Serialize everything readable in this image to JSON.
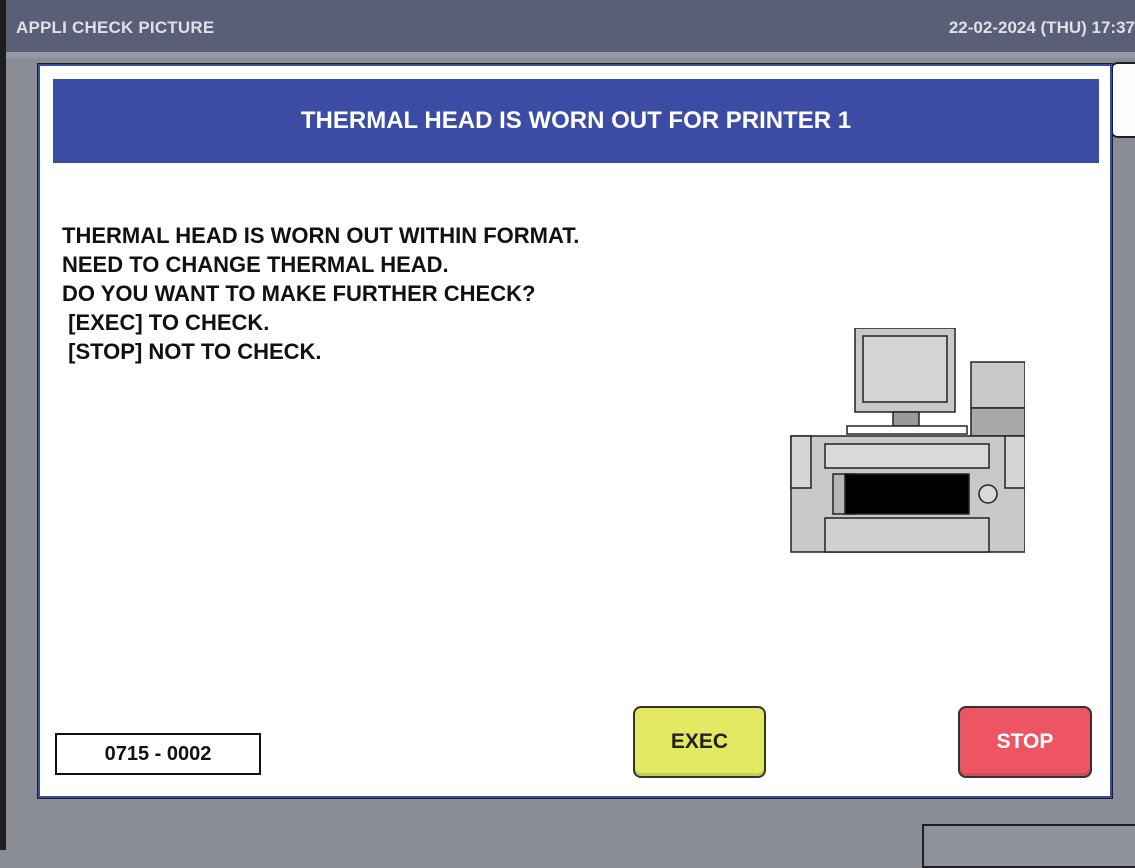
{
  "titlebar": {
    "app_name": "APPLI CHECK PICTURE",
    "datetime": "22-02-2024 (THU)  17:37"
  },
  "dialog": {
    "title": "THERMAL HEAD IS WORN OUT FOR PRINTER 1",
    "message_lines": [
      "THERMAL HEAD IS WORN OUT WITHIN FORMAT.",
      "NEED TO CHANGE THERMAL HEAD.",
      "DO YOU WANT TO MAKE FURTHER CHECK?",
      " [EXEC] TO CHECK.",
      " [STOP] NOT TO CHECK."
    ],
    "code": "0715 - 0002",
    "exec_label": "EXEC",
    "stop_label": "STOP",
    "illustration_icon": "printer-icon"
  },
  "colors": {
    "titlebar_bg": "#5a5e76",
    "header_bg": "#3c4ba4",
    "exec_bg": "#e4e964",
    "stop_bg": "#ee5563"
  }
}
